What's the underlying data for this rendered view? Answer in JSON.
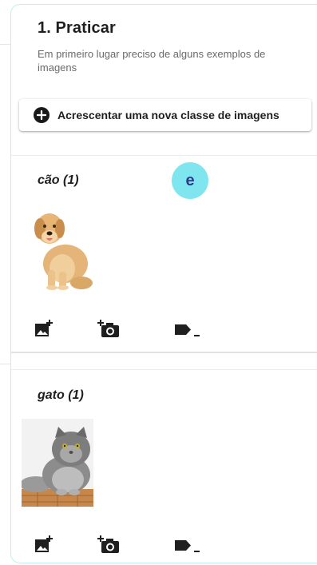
{
  "section": {
    "title": "1. Praticar",
    "subtitle": "Em primeiro lugar preciso de alguns exemplos de imagens"
  },
  "add_class_button": {
    "label": "Acrescentar uma nova classe de imagens",
    "icon": "plus-circle-icon"
  },
  "user_avatar": {
    "initial": "e",
    "color": "#7fe6ef"
  },
  "classes": [
    {
      "label": "cão (1)",
      "image": "golden-retriever-photo",
      "actions": [
        "add-image-icon",
        "camera-add-icon",
        "label-remove-icon"
      ]
    },
    {
      "label": "gato (1)",
      "image": "grey-persian-cat-photo",
      "actions": [
        "add-image-icon",
        "camera-add-icon",
        "label-remove-icon"
      ]
    }
  ],
  "colors": {
    "panel_border": "#bfeff2",
    "accent": "#7fe6ef",
    "text": "#1f1f1f",
    "muted": "#6a6a6a"
  }
}
